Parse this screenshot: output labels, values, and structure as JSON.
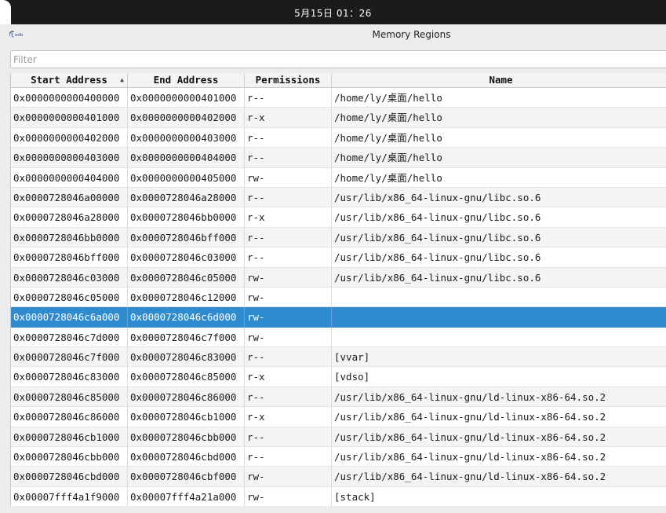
{
  "system_bar": {
    "clock": "5月15日  01：26"
  },
  "window": {
    "title": "Memory Regions",
    "app_icon": "edb-icon"
  },
  "filter": {
    "placeholder": "Filter",
    "value": ""
  },
  "table": {
    "columns": [
      "Start Address",
      "End Address",
      "Permissions",
      "Name"
    ],
    "sort_column": "Start Address",
    "sort_direction": "ascending",
    "selected_index": 11,
    "rows": [
      {
        "start": "0x0000000000400000",
        "end": "0x0000000000401000",
        "perm": "r--",
        "name": "/home/ly/桌面/hello"
      },
      {
        "start": "0x0000000000401000",
        "end": "0x0000000000402000",
        "perm": "r-x",
        "name": "/home/ly/桌面/hello"
      },
      {
        "start": "0x0000000000402000",
        "end": "0x0000000000403000",
        "perm": "r--",
        "name": "/home/ly/桌面/hello"
      },
      {
        "start": "0x0000000000403000",
        "end": "0x0000000000404000",
        "perm": "r--",
        "name": "/home/ly/桌面/hello"
      },
      {
        "start": "0x0000000000404000",
        "end": "0x0000000000405000",
        "perm": "rw-",
        "name": "/home/ly/桌面/hello"
      },
      {
        "start": "0x0000728046a00000",
        "end": "0x0000728046a28000",
        "perm": "r--",
        "name": "/usr/lib/x86_64-linux-gnu/libc.so.6"
      },
      {
        "start": "0x0000728046a28000",
        "end": "0x0000728046bb0000",
        "perm": "r-x",
        "name": "/usr/lib/x86_64-linux-gnu/libc.so.6"
      },
      {
        "start": "0x0000728046bb0000",
        "end": "0x0000728046bff000",
        "perm": "r--",
        "name": "/usr/lib/x86_64-linux-gnu/libc.so.6"
      },
      {
        "start": "0x0000728046bff000",
        "end": "0x0000728046c03000",
        "perm": "r--",
        "name": "/usr/lib/x86_64-linux-gnu/libc.so.6"
      },
      {
        "start": "0x0000728046c03000",
        "end": "0x0000728046c05000",
        "perm": "rw-",
        "name": "/usr/lib/x86_64-linux-gnu/libc.so.6"
      },
      {
        "start": "0x0000728046c05000",
        "end": "0x0000728046c12000",
        "perm": "rw-",
        "name": ""
      },
      {
        "start": "0x0000728046c6a000",
        "end": "0x0000728046c6d000",
        "perm": "rw-",
        "name": ""
      },
      {
        "start": "0x0000728046c7d000",
        "end": "0x0000728046c7f000",
        "perm": "rw-",
        "name": ""
      },
      {
        "start": "0x0000728046c7f000",
        "end": "0x0000728046c83000",
        "perm": "r--",
        "name": "[vvar]"
      },
      {
        "start": "0x0000728046c83000",
        "end": "0x0000728046c85000",
        "perm": "r-x",
        "name": "[vdso]"
      },
      {
        "start": "0x0000728046c85000",
        "end": "0x0000728046c86000",
        "perm": "r--",
        "name": "/usr/lib/x86_64-linux-gnu/ld-linux-x86-64.so.2"
      },
      {
        "start": "0x0000728046c86000",
        "end": "0x0000728046cb1000",
        "perm": "r-x",
        "name": "/usr/lib/x86_64-linux-gnu/ld-linux-x86-64.so.2"
      },
      {
        "start": "0x0000728046cb1000",
        "end": "0x0000728046cbb000",
        "perm": "r--",
        "name": "/usr/lib/x86_64-linux-gnu/ld-linux-x86-64.so.2"
      },
      {
        "start": "0x0000728046cbb000",
        "end": "0x0000728046cbd000",
        "perm": "r--",
        "name": "/usr/lib/x86_64-linux-gnu/ld-linux-x86-64.so.2"
      },
      {
        "start": "0x0000728046cbd000",
        "end": "0x0000728046cbf000",
        "perm": "rw-",
        "name": "/usr/lib/x86_64-linux-gnu/ld-linux-x86-64.so.2"
      },
      {
        "start": "0x00007fff4a1f9000",
        "end": "0x00007fff4a21a000",
        "perm": "rw-",
        "name": "[stack]"
      }
    ]
  }
}
